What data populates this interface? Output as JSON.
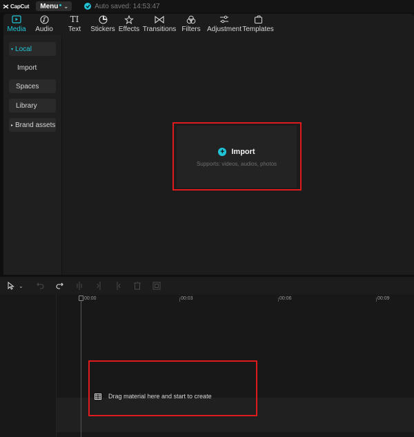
{
  "app": {
    "logo_text": "CapCut",
    "menu_label": "Menu",
    "autosave_text": "Auto saved: 14:53:47",
    "accent_color": "#21c7d9",
    "highlight_color": "#e01b1b"
  },
  "toolbar": {
    "tabs": [
      {
        "label": "Media",
        "icon": "media-icon",
        "active": true
      },
      {
        "label": "Audio",
        "icon": "audio-icon"
      },
      {
        "label": "Text",
        "icon": "text-icon"
      },
      {
        "label": "Stickers",
        "icon": "stickers-icon"
      },
      {
        "label": "Effects",
        "icon": "effects-icon"
      },
      {
        "label": "Transitions",
        "icon": "transitions-icon"
      },
      {
        "label": "Filters",
        "icon": "filters-icon"
      },
      {
        "label": "Adjustment",
        "icon": "adjustment-icon"
      },
      {
        "label": "Templates",
        "icon": "templates-icon"
      }
    ]
  },
  "sidebar": {
    "items": [
      {
        "label": "Local",
        "active": true
      },
      {
        "label": "Import"
      },
      {
        "label": "Spaces"
      },
      {
        "label": "Library"
      },
      {
        "label": "Brand assets"
      }
    ]
  },
  "import_panel": {
    "button_label": "Import",
    "supports_text": "Supports: videos, audios, photos"
  },
  "timeline": {
    "ticks": [
      "00:00",
      "00:03",
      "00:06",
      "00:09"
    ],
    "drop_hint": "Drag material here and start to create"
  }
}
